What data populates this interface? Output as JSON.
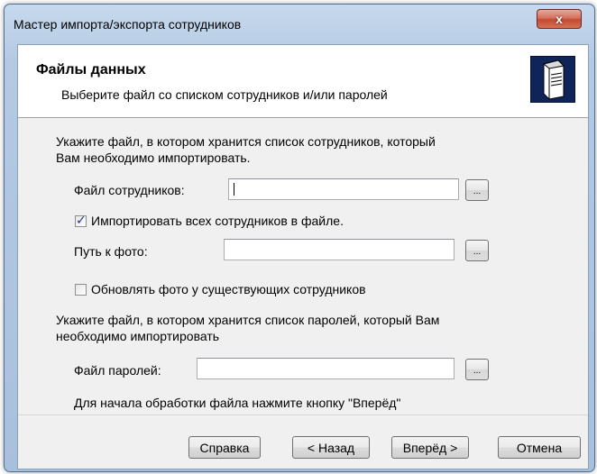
{
  "window": {
    "title": "Мастер импорта/экспорта сотрудников",
    "close_glyph": "x"
  },
  "header": {
    "title": "Файлы данных",
    "subtitle": "Выберите файл со списком сотрудников и/или паролей",
    "icon": "server-icon"
  },
  "employees": {
    "instruction_line1": "Укажите файл, в котором хранится список сотрудников, который",
    "instruction_line2": "Вам необходимо импортировать.",
    "file_label": "Файл сотрудников:",
    "file_value": "",
    "browse_label": "...",
    "import_all_label": "Импортировать всех сотрудников в файле.",
    "import_all_checked": true,
    "photo_label": "Путь к фото:",
    "photo_value": "",
    "photo_browse_label": "...",
    "update_photo_label": "Обновлять фото у существующих сотрудников",
    "update_photo_checked": false
  },
  "passwords": {
    "instruction_line1": "Укажите файл, в котором хранится список паролей, который Вам",
    "instruction_line2": "необходимо импортировать",
    "file_label": "Файл паролей:",
    "file_value": "",
    "browse_label": "..."
  },
  "hint": "Для начала обработки файла нажмите кнопку \"Вперёд\"",
  "buttons": {
    "help": "Справка",
    "back": "< Назад",
    "next": "Вперёд >",
    "cancel": "Отмена"
  }
}
